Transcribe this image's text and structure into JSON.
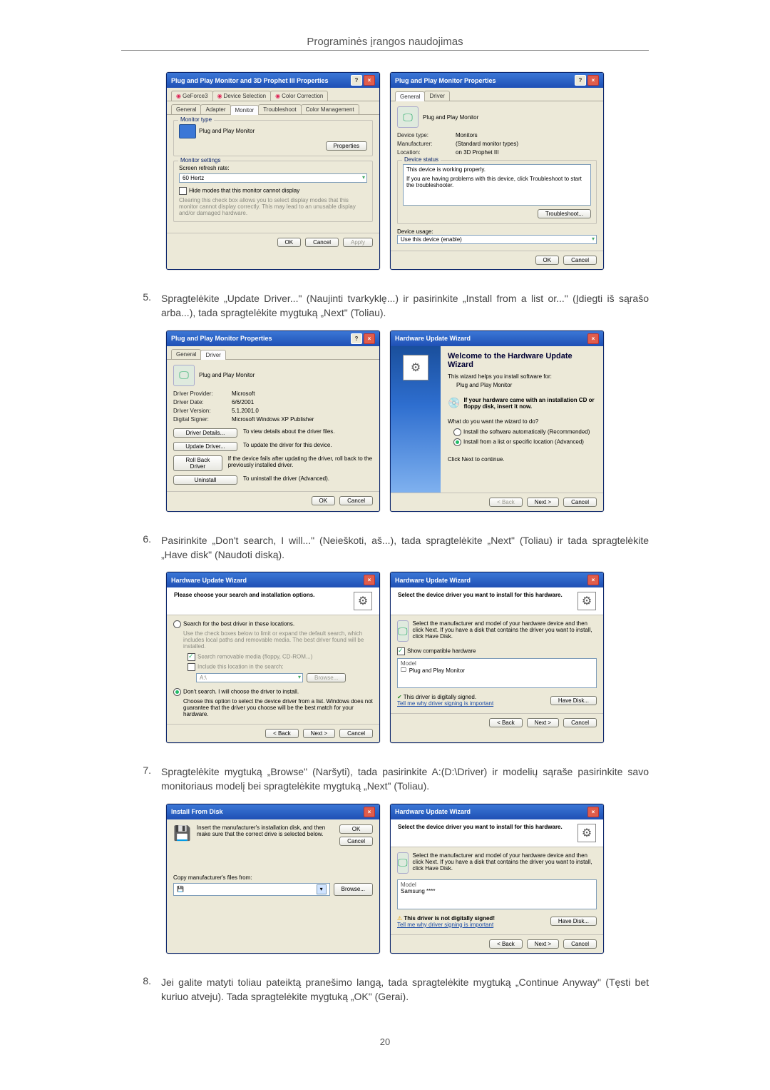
{
  "doc": {
    "header": "Programinės įrangos naudojimas",
    "page_number": "20"
  },
  "steps": {
    "s5_num": "5.",
    "s5_text": "Spragtelėkite „Update Driver...\" (Naujinti tvarkyklę...) ir pasirinkite „Install from a list or...\" (Įdiegti iš sąrašo arba...), tada spragtelėkite mygtuką „Next\" (Toliau).",
    "s6_num": "6.",
    "s6_text": "Pasirinkite „Don't search, I will...\" (Neieškoti, aš...), tada spragtelėkite „Next\" (Toliau) ir tada spragtelėkite „Have disk\" (Naudoti diską).",
    "s7_num": "7.",
    "s7_text": "Spragtelėkite mygtuką „Browse\" (Naršyti), tada pasirinkite A:(D:\\Driver) ir modelių sąraše pasirinkite savo monitoriaus modelį bei spragtelėkite mygtuką „Next\" (Toliau).",
    "s8_num": "8.",
    "s8_text": "Jei galite matyti toliau pateiktą pranešimo langą, tada spragtelėkite mygtuką „Continue Anyway\" (Tęsti bet kuriuo atveju). Tada spragtelėkite mygtuką „OK\" (Gerai)."
  },
  "common": {
    "ok": "OK",
    "cancel": "Cancel",
    "apply": "Apply",
    "back": "< Back",
    "next": "Next >",
    "browse": "Browse...",
    "troubleshoot": "Troubleshoot...",
    "have_disk": "Have Disk..."
  },
  "dlg1a": {
    "title": "Plug and Play Monitor and 3D Prophet III Properties",
    "tabs": {
      "geforce": "GeForce3",
      "device_sel": "Device Selection",
      "color_corr": "Color Correction",
      "general": "General",
      "adapter": "Adapter",
      "monitor": "Monitor",
      "troubleshoot": "Troubleshoot",
      "color_mgmt": "Color Management"
    },
    "monitor_type": "Monitor type",
    "monitor_name": "Plug and Play Monitor",
    "properties_btn": "Properties",
    "monitor_settings": "Monitor settings",
    "refresh_label": "Screen refresh rate:",
    "refresh_value": "60 Hertz",
    "hide_modes": "Hide modes that this monitor cannot display",
    "hide_desc": "Clearing this check box allows you to select display modes that this monitor cannot display correctly. This may lead to an unusable display and/or damaged hardware."
  },
  "dlg1b": {
    "title": "Plug and Play Monitor Properties",
    "tab_general": "General",
    "tab_driver": "Driver",
    "device_name": "Plug and Play Monitor",
    "k_devtype": "Device type:",
    "v_devtype": "Monitors",
    "k_manuf": "Manufacturer:",
    "v_manuf": "(Standard monitor types)",
    "k_loc": "Location:",
    "v_loc": "on 3D Prophet III",
    "status_legend": "Device status",
    "status_line1": "This device is working properly.",
    "status_line2": "If you are having problems with this device, click Troubleshoot to start the troubleshooter.",
    "usage_label": "Device usage:",
    "usage_value": "Use this device (enable)"
  },
  "dlg2a": {
    "title": "Plug and Play Monitor Properties",
    "tab_general": "General",
    "tab_driver": "Driver",
    "device_name": "Plug and Play Monitor",
    "k_prov": "Driver Provider:",
    "v_prov": "Microsoft",
    "k_date": "Driver Date:",
    "v_date": "6/6/2001",
    "k_ver": "Driver Version:",
    "v_ver": "5.1.2001.0",
    "k_sign": "Digital Signer:",
    "v_sign": "Microsoft Windows XP Publisher",
    "btn_details": "Driver Details...",
    "btn_details_desc": "To view details about the driver files.",
    "btn_update": "Update Driver...",
    "btn_update_desc": "To update the driver for this device.",
    "btn_rollback": "Roll Back Driver",
    "btn_rollback_desc": "If the device fails after updating the driver, roll back to the previously installed driver.",
    "btn_uninstall": "Uninstall",
    "btn_uninstall_desc": "To uninstall the driver (Advanced)."
  },
  "dlg2b": {
    "title": "Hardware Update Wizard",
    "welcome": "Welcome to the Hardware Update Wizard",
    "intro": "This wizard helps you install software for:",
    "device": "Plug and Play Monitor",
    "cd_hint": "If your hardware came with an installation CD or floppy disk, insert it now.",
    "what_do": "What do you want the wizard to do?",
    "opt_auto": "Install the software automatically (Recommended)",
    "opt_list": "Install from a list or specific location (Advanced)",
    "click_next": "Click Next to continue."
  },
  "dlg3a": {
    "title": "Hardware Update Wizard",
    "heading": "Please choose your search and installation options.",
    "opt_search": "Search for the best driver in these locations.",
    "search_desc": "Use the check boxes below to limit or expand the default search, which includes local paths and removable media. The best driver found will be installed.",
    "chk_media": "Search removable media (floppy, CD-ROM...)",
    "chk_include": "Include this location in the search:",
    "path_value": "A:\\",
    "opt_dont": "Don't search. I will choose the driver to install.",
    "dont_desc": "Choose this option to select the device driver from a list. Windows does not guarantee that the driver you choose will be the best match for your hardware."
  },
  "dlg3b": {
    "title": "Hardware Update Wizard",
    "heading": "Select the device driver you want to install for this hardware.",
    "desc": "Select the manufacturer and model of your hardware device and then click Next. If you have a disk that contains the driver you want to install, click Have Disk.",
    "show_compat": "Show compatible hardware",
    "model_label": "Model",
    "model_value": "Plug and Play Monitor",
    "signed": "This driver is digitally signed.",
    "why": "Tell me why driver signing is important"
  },
  "dlg4a": {
    "title": "Install From Disk",
    "instr": "Insert the manufacturer's installation disk, and then make sure that the correct drive is selected below.",
    "copy_from": "Copy manufacturer's files from:"
  },
  "dlg4b": {
    "title": "Hardware Update Wizard",
    "heading": "Select the device driver you want to install for this hardware.",
    "desc": "Select the manufacturer and model of your hardware device and then click Next. If you have a disk that contains the driver you want to install, click Have Disk.",
    "model_label": "Model",
    "model_value": "Samsung ****",
    "not_signed": "This driver is not digitally signed!",
    "why": "Tell me why driver signing is important"
  }
}
